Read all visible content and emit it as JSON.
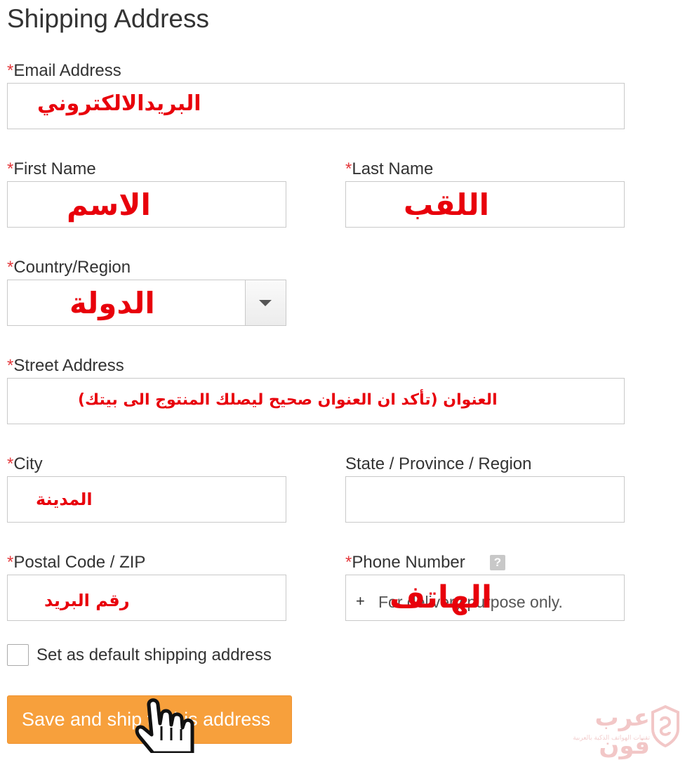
{
  "page": {
    "title": "Shipping Address"
  },
  "required_marker": "*",
  "fields": {
    "email": {
      "label": "Email Address",
      "annotation": "البريدالالكتروني"
    },
    "first_name": {
      "label": "First Name",
      "annotation": "الاسم"
    },
    "last_name": {
      "label": "Last Name",
      "annotation": "اللقب"
    },
    "country": {
      "label": "Country/Region",
      "annotation": "الدولة"
    },
    "street": {
      "label": "Street Address",
      "annotation": "العنوان (تأكد ان العنوان صحيح ليصلك المنتوج الى بيتك)"
    },
    "city": {
      "label": "City",
      "annotation": "المدينة"
    },
    "state": {
      "label": "State / Province / Region"
    },
    "postal": {
      "label": "Postal Code / ZIP",
      "annotation": "رقم البريد"
    },
    "phone": {
      "label": "Phone Number",
      "prefix": "+",
      "placeholder": "For delivery purpose only.",
      "annotation": "الهاتف",
      "help": "?"
    }
  },
  "default_checkbox": {
    "label": "Set as default shipping address",
    "checked": false
  },
  "save_button": {
    "label": "Save and ship to this address"
  },
  "watermark": {
    "text": "عرب فون",
    "subtext": "تقنيات الهواتف الذكية بالعربية"
  },
  "colors": {
    "accent": "#f7a03c",
    "required": "#e4393c",
    "annotation": "#e8000b"
  },
  "icons": {
    "dropdown": "chevron-down-icon",
    "help": "question-icon",
    "cursor": "hand-pointer-icon"
  }
}
